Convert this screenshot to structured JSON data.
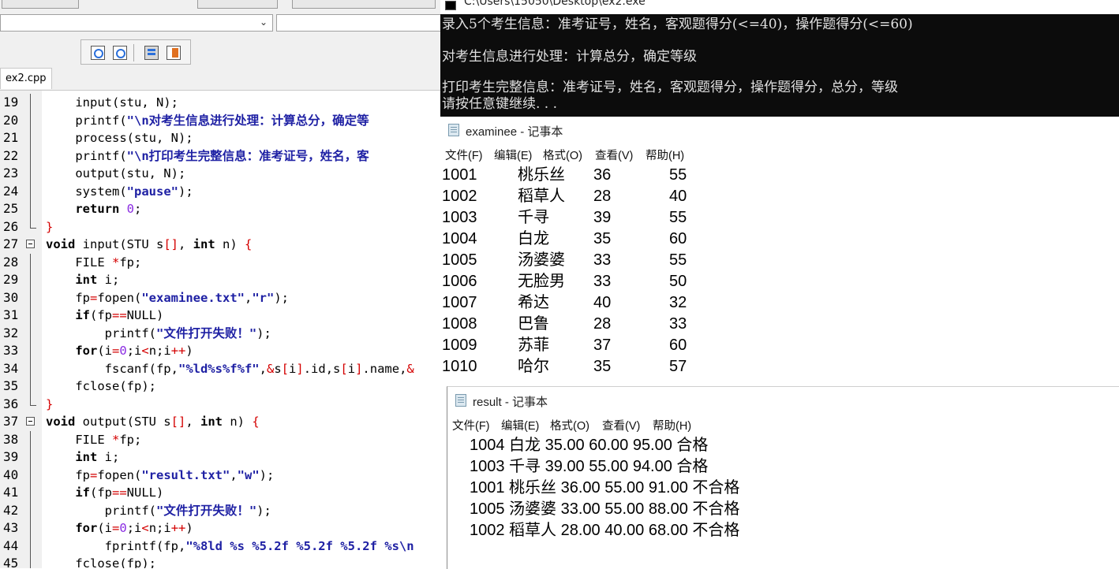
{
  "ide": {
    "tab_label": "ex2.cpp",
    "lines": [
      {
        "n": "19",
        "fold": "line",
        "tokens": [
          [
            "plain",
            "    input(stu, N);"
          ]
        ]
      },
      {
        "n": "20",
        "fold": "line",
        "tokens": [
          [
            "plain",
            "    printf("
          ],
          [
            "s",
            "\"\\n对考生信息进行处理：计算总分，确定等"
          ]
        ]
      },
      {
        "n": "21",
        "fold": "line",
        "tokens": [
          [
            "plain",
            "    process(stu, N);"
          ]
        ]
      },
      {
        "n": "22",
        "fold": "line",
        "tokens": [
          [
            "plain",
            "    printf("
          ],
          [
            "s",
            "\"\\n打印考生完整信息：准考证号，姓名，客"
          ]
        ]
      },
      {
        "n": "23",
        "fold": "line",
        "tokens": [
          [
            "plain",
            "    output(stu, N);"
          ]
        ]
      },
      {
        "n": "24",
        "fold": "line",
        "tokens": [
          [
            "plain",
            "    system("
          ],
          [
            "s",
            "\"pause\""
          ],
          [
            "plain",
            ");"
          ]
        ]
      },
      {
        "n": "25",
        "fold": "line",
        "tokens": [
          [
            "plain",
            "    "
          ],
          [
            "k",
            "return"
          ],
          [
            "plain",
            " "
          ],
          [
            "n",
            "0"
          ],
          [
            "plain",
            ";"
          ]
        ]
      },
      {
        "n": "26",
        "fold": "end",
        "tokens": [
          [
            "p",
            "}"
          ]
        ]
      },
      {
        "n": "27",
        "fold": "box",
        "tokens": [
          [
            "k",
            "void"
          ],
          [
            "plain",
            " input(STU s"
          ],
          [
            "p",
            "[]"
          ],
          [
            "plain",
            ", "
          ],
          [
            "k",
            "int"
          ],
          [
            "plain",
            " n) "
          ],
          [
            "p",
            "{"
          ]
        ]
      },
      {
        "n": "28",
        "fold": "line",
        "tokens": [
          [
            "plain",
            "    FILE "
          ],
          [
            "p",
            "*"
          ],
          [
            "plain",
            "fp;"
          ]
        ]
      },
      {
        "n": "29",
        "fold": "line",
        "tokens": [
          [
            "plain",
            "    "
          ],
          [
            "k",
            "int"
          ],
          [
            "plain",
            " i;"
          ]
        ]
      },
      {
        "n": "30",
        "fold": "line",
        "tokens": [
          [
            "plain",
            "    fp"
          ],
          [
            "p",
            "="
          ],
          [
            "plain",
            "fopen("
          ],
          [
            "s",
            "\"examinee.txt\""
          ],
          [
            "plain",
            ","
          ],
          [
            "s",
            "\"r\""
          ],
          [
            "plain",
            ");"
          ]
        ]
      },
      {
        "n": "31",
        "fold": "line",
        "tokens": [
          [
            "plain",
            "    "
          ],
          [
            "k",
            "if"
          ],
          [
            "plain",
            "(fp"
          ],
          [
            "p",
            "=="
          ],
          [
            "plain",
            "NULL)"
          ]
        ]
      },
      {
        "n": "32",
        "fold": "line",
        "tokens": [
          [
            "plain",
            "        printf("
          ],
          [
            "s",
            "\"文件打开失败！\""
          ],
          [
            "plain",
            ");"
          ]
        ]
      },
      {
        "n": "33",
        "fold": "line",
        "tokens": [
          [
            "plain",
            "    "
          ],
          [
            "k",
            "for"
          ],
          [
            "plain",
            "(i"
          ],
          [
            "p",
            "="
          ],
          [
            "n",
            "0"
          ],
          [
            "plain",
            ";i"
          ],
          [
            "p",
            "<"
          ],
          [
            "plain",
            "n;i"
          ],
          [
            "p",
            "++"
          ],
          [
            "plain",
            ")"
          ]
        ]
      },
      {
        "n": "34",
        "fold": "line",
        "tokens": [
          [
            "plain",
            "        fscanf(fp,"
          ],
          [
            "s",
            "\"%ld%s%f%f\""
          ],
          [
            "plain",
            ","
          ],
          [
            "p",
            "&"
          ],
          [
            "plain",
            "s"
          ],
          [
            "p",
            "["
          ],
          [
            "plain",
            "i"
          ],
          [
            "p",
            "]"
          ],
          [
            "plain",
            ".id,s"
          ],
          [
            "p",
            "["
          ],
          [
            "plain",
            "i"
          ],
          [
            "p",
            "]"
          ],
          [
            "plain",
            ".name,"
          ],
          [
            "p",
            "&"
          ]
        ]
      },
      {
        "n": "35",
        "fold": "line",
        "tokens": [
          [
            "plain",
            "    fclose(fp);"
          ]
        ]
      },
      {
        "n": "36",
        "fold": "end",
        "tokens": [
          [
            "p",
            "}"
          ]
        ]
      },
      {
        "n": "37",
        "fold": "box",
        "tokens": [
          [
            "k",
            "void"
          ],
          [
            "plain",
            " output(STU s"
          ],
          [
            "p",
            "[]"
          ],
          [
            "plain",
            ", "
          ],
          [
            "k",
            "int"
          ],
          [
            "plain",
            " n) "
          ],
          [
            "p",
            "{"
          ]
        ]
      },
      {
        "n": "38",
        "fold": "line",
        "tokens": [
          [
            "plain",
            "    FILE "
          ],
          [
            "p",
            "*"
          ],
          [
            "plain",
            "fp;"
          ]
        ]
      },
      {
        "n": "39",
        "fold": "line",
        "tokens": [
          [
            "plain",
            "    "
          ],
          [
            "k",
            "int"
          ],
          [
            "plain",
            " i;"
          ]
        ]
      },
      {
        "n": "40",
        "fold": "line",
        "tokens": [
          [
            "plain",
            "    fp"
          ],
          [
            "p",
            "="
          ],
          [
            "plain",
            "fopen("
          ],
          [
            "s",
            "\"result.txt\""
          ],
          [
            "plain",
            ","
          ],
          [
            "s",
            "\"w\""
          ],
          [
            "plain",
            ");"
          ]
        ]
      },
      {
        "n": "41",
        "fold": "line",
        "tokens": [
          [
            "plain",
            "    "
          ],
          [
            "k",
            "if"
          ],
          [
            "plain",
            "(fp"
          ],
          [
            "p",
            "=="
          ],
          [
            "plain",
            "NULL)"
          ]
        ]
      },
      {
        "n": "42",
        "fold": "line",
        "tokens": [
          [
            "plain",
            "        printf("
          ],
          [
            "s",
            "\"文件打开失败！\""
          ],
          [
            "plain",
            ");"
          ]
        ]
      },
      {
        "n": "43",
        "fold": "line",
        "tokens": [
          [
            "plain",
            "    "
          ],
          [
            "k",
            "for"
          ],
          [
            "plain",
            "(i"
          ],
          [
            "p",
            "="
          ],
          [
            "n",
            "0"
          ],
          [
            "plain",
            ";i"
          ],
          [
            "p",
            "<"
          ],
          [
            "plain",
            "n;i"
          ],
          [
            "p",
            "++"
          ],
          [
            "plain",
            ")"
          ]
        ]
      },
      {
        "n": "44",
        "fold": "line",
        "tokens": [
          [
            "plain",
            "        fprintf(fp,"
          ],
          [
            "s",
            "\"%8ld %s %5.2f %5.2f %5.2f %s\\n"
          ]
        ]
      },
      {
        "n": "45",
        "fold": "line",
        "tokens": [
          [
            "plain",
            "    fclose(fp);"
          ]
        ]
      }
    ]
  },
  "console": {
    "title": "C:\\Users\\15050\\Desktop\\ex2.exe",
    "lines": [
      "录入5个考生信息：准考证号，姓名，客观题得分(<=40)，操作题得分(<=60)",
      "",
      "对考生信息进行处理：计算总分，确定等级",
      "",
      "打印考生完整信息：准考证号，姓名，客观题得分，操作题得分，总分，等级",
      "请按任意键继续. . ."
    ]
  },
  "examinee": {
    "title": "examinee - 记事本",
    "menu": [
      "文件(F)",
      "编辑(E)",
      "格式(O)",
      "查看(V)",
      "帮助(H)"
    ],
    "rows": [
      [
        "1001",
        "桃乐丝",
        "36",
        "55"
      ],
      [
        "1002",
        "稻草人",
        "28",
        "40"
      ],
      [
        "1003",
        "千寻",
        "39",
        "55"
      ],
      [
        "1004",
        "白龙",
        "35",
        "60"
      ],
      [
        "1005",
        "汤婆婆",
        "33",
        "55"
      ],
      [
        "1006",
        "无脸男",
        "33",
        "50"
      ],
      [
        "1007",
        "希达",
        "40",
        "32"
      ],
      [
        "1008",
        "巴鲁",
        "28",
        "33"
      ],
      [
        "1009",
        "苏菲",
        "37",
        "60"
      ],
      [
        "1010",
        "哈尔",
        "35",
        "57"
      ]
    ]
  },
  "result": {
    "title": "result - 记事本",
    "menu": [
      "文件(F)",
      "编辑(E)",
      "格式(O)",
      "查看(V)",
      "帮助(H)"
    ],
    "rows": [
      "1004 白龙 35.00 60.00 95.00 合格",
      "1003 千寻 39.00 55.00 94.00 合格",
      "1001 桃乐丝 36.00 55.00 91.00 不合格",
      "1005 汤婆婆 33.00 55.00 88.00 不合格",
      "1002 稻草人 28.00 40.00 68.00 不合格"
    ]
  }
}
